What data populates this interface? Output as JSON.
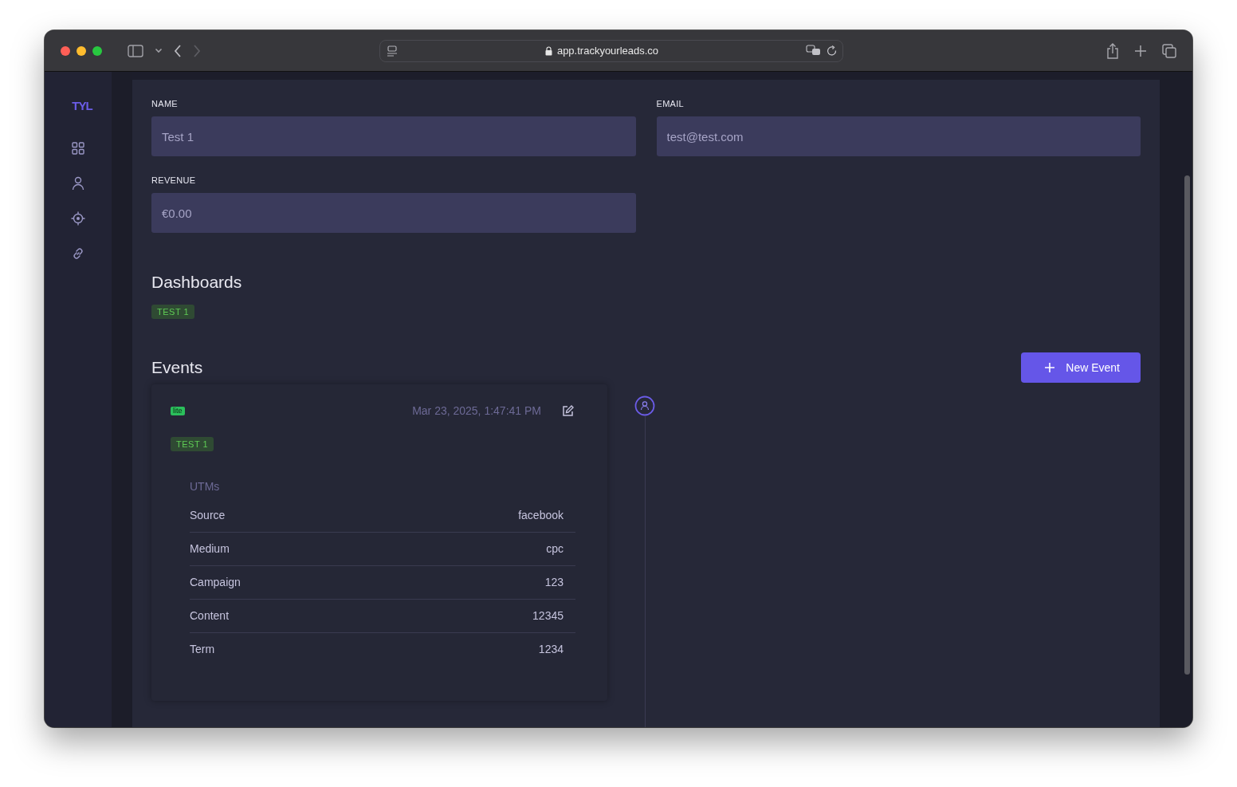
{
  "browser": {
    "url": "app.trackyourleads.co"
  },
  "sidebar": {
    "logo": "TYL",
    "items": [
      {
        "kind": "grid",
        "selected": false
      },
      {
        "kind": "person",
        "selected": false
      },
      {
        "kind": "target",
        "selected": false
      },
      {
        "kind": "link",
        "selected": false
      }
    ]
  },
  "form": {
    "fields": [
      {
        "label": "NAME",
        "value": "Test 1"
      },
      {
        "label": "EMAIL",
        "value": "test@test.com"
      },
      {
        "label": "REVENUE",
        "value": "€0.00"
      }
    ]
  },
  "dashboards": {
    "title": "Dashboards",
    "tags": [
      "TEST 1"
    ]
  },
  "events": {
    "title": "Events",
    "new_button": "New Event",
    "items": [
      {
        "source_badge": "lite",
        "timestamp": "Mar 23, 2025, 1:47:41 PM",
        "tags": [
          "TEST 1"
        ],
        "utm_title": "UTMs",
        "utms": [
          {
            "key": "Source",
            "value": "facebook"
          },
          {
            "key": "Medium",
            "value": "cpc"
          },
          {
            "key": "Campaign",
            "value": "123"
          },
          {
            "key": "Content",
            "value": "12345"
          },
          {
            "key": "Term",
            "value": "1234"
          }
        ]
      }
    ]
  }
}
